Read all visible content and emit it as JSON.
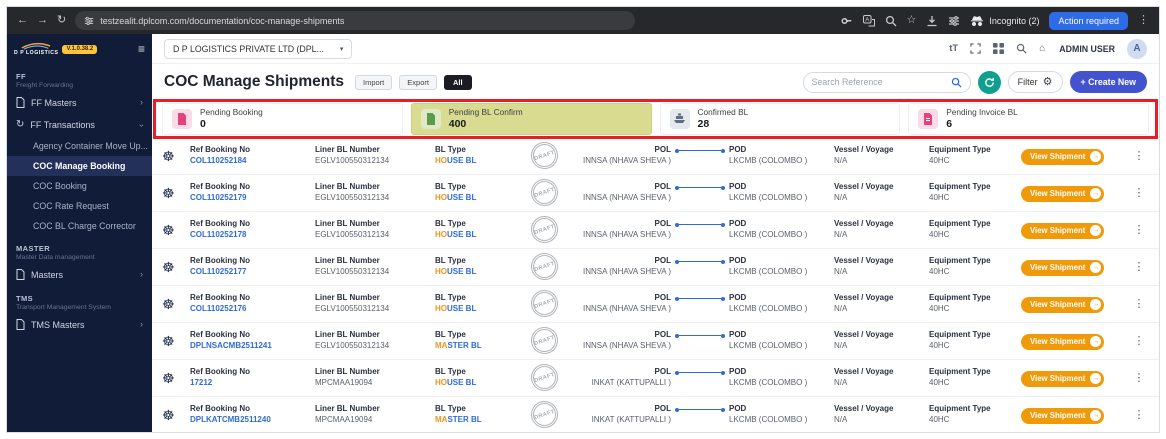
{
  "browser": {
    "url": "testzealit.dplcom.com/documentation/coc-manage-shipments",
    "incognito_label": "Incognito (2)",
    "action_required_label": "Action required"
  },
  "header": {
    "company_selector": "D P LOGISTICS PRIVATE LTD  (DPL...",
    "user_name": "ADMIN USER",
    "avatar_initial": "A"
  },
  "sidebar": {
    "logo": "D P LOGISTICS",
    "version": "V.1.0.38.2",
    "ff": {
      "heading": "FF",
      "caption": "Freight Forwarding"
    },
    "master": {
      "heading": "MASTER",
      "caption": "Master Data management"
    },
    "tms": {
      "heading": "TMS",
      "caption": "Transport Management System"
    },
    "items": {
      "ff_masters": "FF Masters",
      "ff_transactions": "FF Transactions",
      "masters": "Masters",
      "tms_masters": "TMS Masters"
    },
    "ff_children": [
      "Agency Container Move Up...",
      "COC Manage Booking",
      "COC Booking",
      "COC Rate Request",
      "COC BL Charge Corrector"
    ],
    "active_item": "COC Manage Booking"
  },
  "page": {
    "title": "COC Manage Shipments",
    "import_label": "Import",
    "export_label": "Export",
    "all_badge": "All",
    "search_placeholder": "Search Reference",
    "filter_label": "Filter",
    "create_new_label": "+ Create New"
  },
  "stats": {
    "cards": [
      {
        "label": "Pending Booking",
        "value": "0",
        "icon": "booking-doc-icon"
      },
      {
        "label": "Pending BL Confirm",
        "value": "400",
        "icon": "bl-doc-icon",
        "highlighted": true
      },
      {
        "label": "Confirmed BL",
        "value": "28",
        "icon": "ship-icon"
      },
      {
        "label": "Pending Invoice BL",
        "value": "6",
        "icon": "invoice-doc-icon"
      }
    ]
  },
  "table": {
    "labels": {
      "ref": "Ref Booking No",
      "liner": "Liner BL Number",
      "bl_type": "BL Type",
      "pol": "POL",
      "pod": "POD",
      "vessel": "Vessel / Voyage",
      "equipment": "Equipment Type",
      "view": "View Shipment",
      "stamp": "DRAFT"
    },
    "rows": [
      {
        "ref": "COL110252184",
        "liner": "EGLV100550312134",
        "bl_type": "HOUSE BL",
        "pol": "INNSA (NHAVA SHEVA )",
        "pod": "LKCMB (COLOMBO )",
        "vessel": "N/A",
        "equipment": "40HC"
      },
      {
        "ref": "COL110252179",
        "liner": "EGLV100550312134",
        "bl_type": "HOUSE BL",
        "pol": "INNSA (NHAVA SHEVA )",
        "pod": "LKCMB (COLOMBO )",
        "vessel": "N/A",
        "equipment": "40HC"
      },
      {
        "ref": "COL110252178",
        "liner": "EGLV100550312134",
        "bl_type": "HOUSE BL",
        "pol": "INNSA (NHAVA SHEVA )",
        "pod": "LKCMB (COLOMBO )",
        "vessel": "N/A",
        "equipment": "40HC"
      },
      {
        "ref": "COL110252177",
        "liner": "EGLV100550312134",
        "bl_type": "HOUSE BL",
        "pol": "INNSA (NHAVA SHEVA )",
        "pod": "LKCMB (COLOMBO )",
        "vessel": "N/A",
        "equipment": "40HC"
      },
      {
        "ref": "COL110252176",
        "liner": "EGLV100550312134",
        "bl_type": "HOUSE BL",
        "pol": "INNSA (NHAVA SHEVA )",
        "pod": "LKCMB (COLOMBO )",
        "vessel": "N/A",
        "equipment": "40HC"
      },
      {
        "ref": "DPLNSACMB2511241",
        "liner": "EGLV100550312134",
        "bl_type": "MASTER BL",
        "pol": "INNSA (NHAVA SHEVA )",
        "pod": "LKCMB (COLOMBO )",
        "vessel": "N/A",
        "equipment": "40HC"
      },
      {
        "ref": "17212",
        "liner": "MPCMAA19094",
        "bl_type": "HOUSE BL",
        "pol": "INKAT (KATTUPALLI )",
        "pod": "LKCMB (COLOMBO )",
        "vessel": "N/A",
        "equipment": "40HC"
      },
      {
        "ref": "DPLKATCMB2511240",
        "liner": "MPCMAA19094",
        "bl_type": "MASTER BL",
        "pol": "INKAT (KATTUPALLI )",
        "pod": "LKCMB (COLOMBO )",
        "vessel": "N/A",
        "equipment": "40HC"
      }
    ]
  },
  "icons": {
    "back": "←",
    "forward": "→",
    "reload": "↻",
    "hamburger": "≡",
    "chevron": "›",
    "caret_down": "▾",
    "ship_wheel": "☸",
    "kebab": "⋮",
    "arrow_right": "→",
    "gear": "⚙",
    "star": "☆",
    "home": "⌂",
    "text_format": "tT"
  },
  "colors": {
    "accent_blue": "#2f6bd8",
    "brand_navy": "#101c38",
    "button_orange": "#f09a0a",
    "teal": "#0e9f8e",
    "create_indigo": "#4353d0",
    "highlight_card": "#d9db90",
    "annotation_red": "#ec1c24",
    "version_badge_yellow": "#ffc43d",
    "bl_type_orange": "#f0941f"
  }
}
